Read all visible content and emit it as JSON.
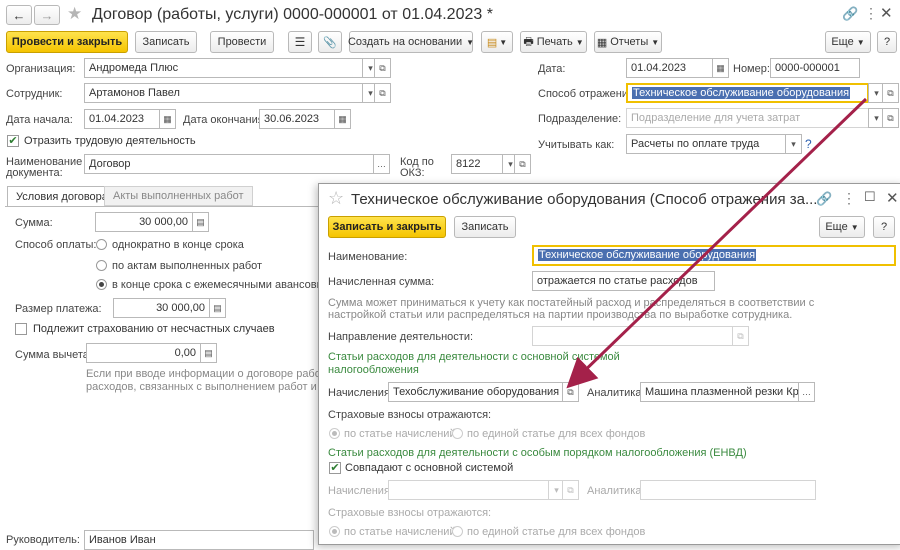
{
  "window": {
    "title": "Договор (работы, услуги) 0000-000001 от 01.04.2023 *"
  },
  "toolbar": {
    "post_close": "Провести и закрыть",
    "save": "Записать",
    "post": "Провести",
    "create_based": "Создать на основании",
    "print": "Печать",
    "reports": "Отчеты",
    "more": "Еще"
  },
  "form": {
    "org_label": "Организация:",
    "org_value": "Андромеда Плюс",
    "employee_label": "Сотрудник:",
    "employee_value": "Артамонов Павел",
    "start_label": "Дата начала:",
    "start_value": "01.04.2023",
    "end_label": "Дата окончания:",
    "end_value": "30.06.2023",
    "labor_checkbox": "Отразить трудовую деятельность",
    "docname_label_1": "Наименование",
    "docname_label_2": "документа:",
    "docname_value": "Договор",
    "okz_label_1": "Код по",
    "okz_label_2": "ОКЗ:",
    "okz_value": "8122",
    "date_label": "Дата:",
    "date_value": "01.04.2023",
    "number_label": "Номер:",
    "number_value": "0000-000001",
    "reflection_label": "Способ отражения:",
    "reflection_value": "Техническое обслуживание оборудования",
    "dept_label": "Подразделение:",
    "dept_placeholder": "Подразделение для учета затрат",
    "account_as_label": "Учитывать как:",
    "account_as_value": "Расчеты по оплате труда",
    "help": "?",
    "manager_label": "Руководитель:",
    "manager_value": "Иванов Иван"
  },
  "tabs": {
    "terms": "Условия договора",
    "acts": "Акты выполненных работ"
  },
  "terms": {
    "sum_label": "Сумма:",
    "sum_value": "30 000,00",
    "payment_label": "Способ оплаты:",
    "pay_opt1": "однократно в конце срока",
    "pay_opt2": "по актам выполненных работ",
    "pay_opt3": "в конце срока с ежемесячными авансовыми п",
    "payment_size_label": "Размер платежа:",
    "payment_size_value": "30 000,00",
    "insurance_checkbox": "Подлежит страхованию от несчастных случаев",
    "deduction_label": "Сумма вычета:",
    "deduction_value": "0,00",
    "note_line1": "Если при вводе информации о договоре работы уж",
    "note_line2": "расходов, связанных с выполнением работ и прин"
  },
  "dialog": {
    "title": "Техническое обслуживание оборудования (Способ отражения за...",
    "save_close": "Записать и закрыть",
    "save": "Записать",
    "more": "Еще",
    "help": "?",
    "name_label": "Наименование:",
    "name_value": "Техническое обслуживание оборудования",
    "accrued_label": "Начисленная сумма:",
    "accrued_value": "отражается по статье расходов",
    "hint_line1": "Сумма может приниматься к учету как постатейный расход и распределяться в соответствии с",
    "hint_line2": "настройкой статьи или распределяться на партии производства по выработке сотрудника.",
    "activity_label": "Направление деятельности:",
    "main_tax_header_1": "Статьи расходов для деятельности с основной системой",
    "main_tax_header_2": "налогообложения",
    "accruals_label": "Начисления:",
    "accruals_value": "Техобслуживание оборудования (по д",
    "analytics_label": "Аналитика:",
    "analytics_value": "Машина плазменной резки Кр",
    "insurance_label": "Страховые взносы отражаются:",
    "ins_opt1": "по статье начислений",
    "ins_opt2": "по единой статье для всех фондов",
    "envd_header": "Статьи расходов для деятельности с особым порядком налогообложения (ЕНВД)",
    "same_checkbox": "Совпадают с основной системой",
    "accruals2_label": "Начисления:",
    "analytics2_label": "Аналитика:",
    "insurance2_label": "Страховые взносы отражаются:",
    "ins2_opt1": "по статье начислений",
    "ins2_opt2": "по единой статье для всех фондов"
  },
  "colors": {
    "accent_yellow": "#f5c400",
    "arrow": "#a4214a",
    "green_header": "#3a8a3f",
    "selection": "#4a6fb0"
  }
}
